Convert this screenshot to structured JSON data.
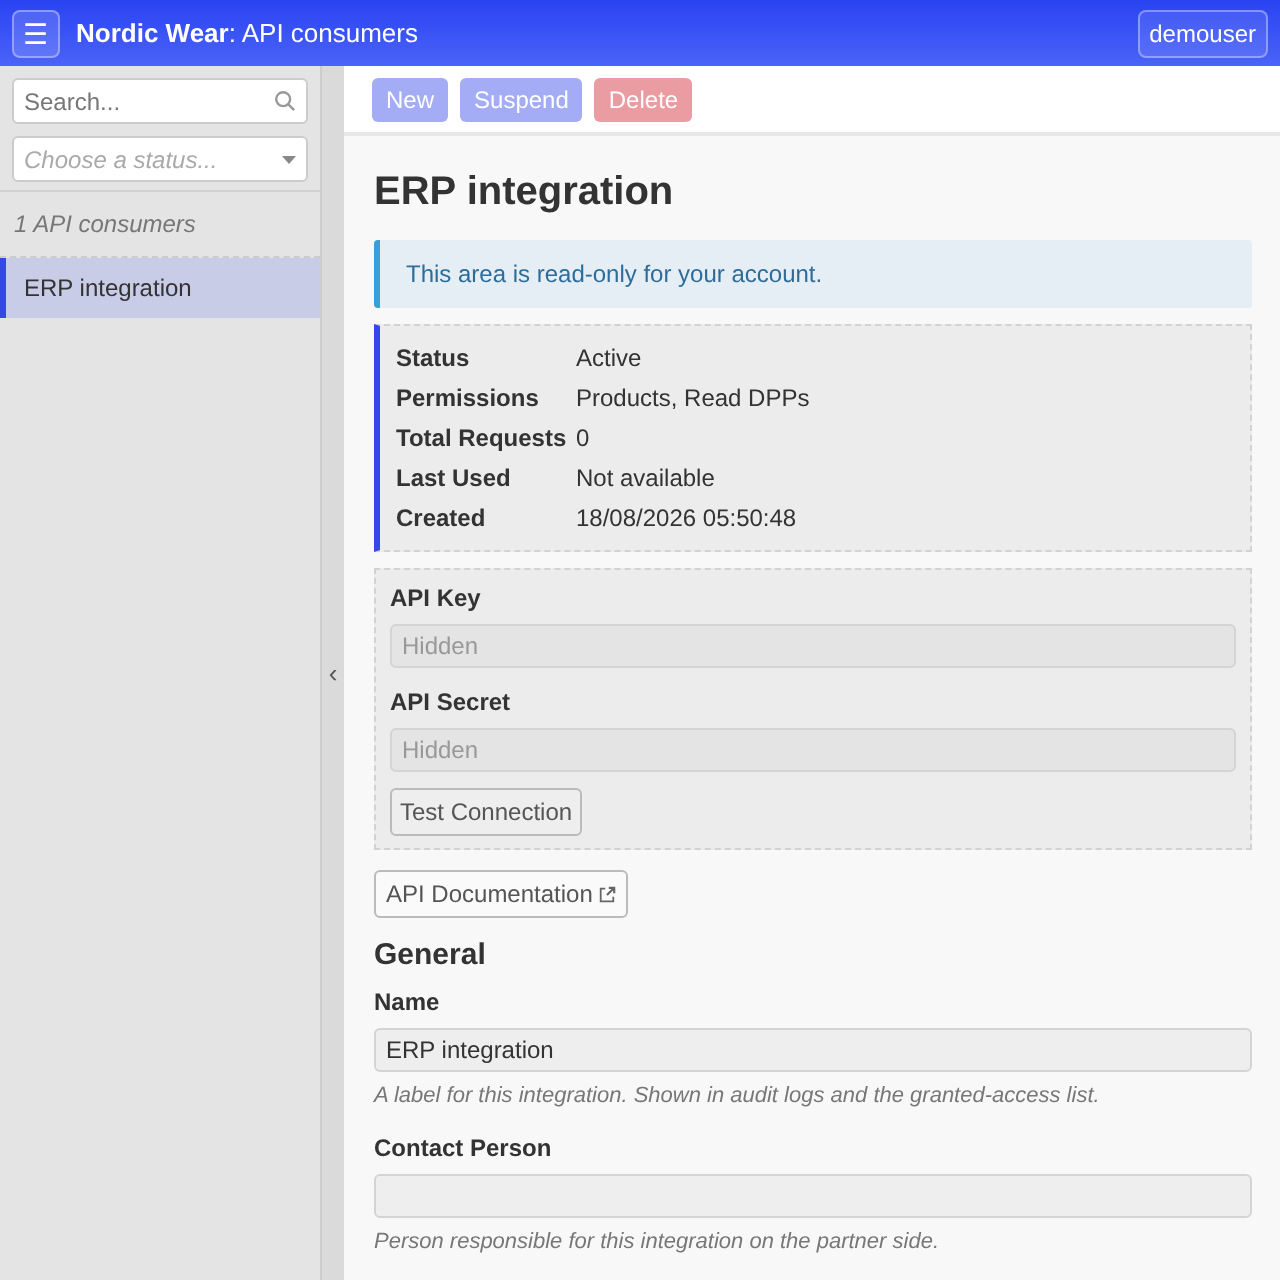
{
  "navbar": {
    "menu_icon": "☰",
    "title": "**Nordic Wear**: API consumers",
    "user": "demouser"
  },
  "sidebar": {
    "search": {
      "placeholder": "Search..."
    },
    "status_select": {
      "placeholder": "Choose a status..."
    },
    "count": "1 API consumers",
    "items": [
      {
        "label": "ERP integration",
        "selected": true
      }
    ],
    "collapse_handle": "‹"
  },
  "toolbar": [
    {
      "label": "New",
      "kind": "primary",
      "disabled": true
    },
    {
      "label": "Suspend",
      "kind": "primary",
      "disabled": true
    },
    {
      "label": "Delete",
      "kind": "danger",
      "disabled": true
    }
  ],
  "title": "ERP integration",
  "notice": "This area is read-only for your account.",
  "details": [
    {
      "label": "Status",
      "value": "Active"
    },
    {
      "label": "Permissions",
      "value": "Products, Read DPPs"
    },
    {
      "label": "Total Requests",
      "value": "0"
    },
    {
      "label": "Last Used",
      "value": "Not available"
    },
    {
      "label": "Created",
      "value": "18/08/2026 05:50:48"
    }
  ],
  "credentials": {
    "fields": [
      {
        "label": "API Key",
        "placeholder": "Hidden",
        "disabled": true
      },
      {
        "label": "API Secret",
        "placeholder": "Hidden",
        "disabled": true
      }
    ],
    "test_button": {
      "label": "Test Connection",
      "disabled": false
    }
  },
  "docs_link": "API Documentation",
  "general": {
    "heading": "General",
    "fields": [
      {
        "label": "Name",
        "value": "ERP integration",
        "help": "A label for this integration. Shown in audit logs and the granted-access list.",
        "disabled": true
      },
      {
        "label": "Contact Person",
        "help": "Person responsible for this integration on the partner side.",
        "disabled": true
      }
    ]
  }
}
